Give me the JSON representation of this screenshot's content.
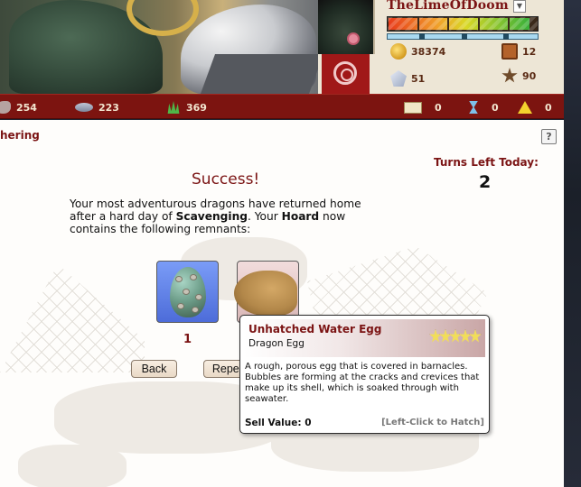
{
  "user": {
    "username": "TheLimeOfDoom",
    "energy_fraction": 0.95,
    "xp_fraction": 0.5,
    "stats": {
      "gold": "38374",
      "gems": "51",
      "books": "12",
      "stars": "90"
    }
  },
  "resources": {
    "ore": "254",
    "stone": "223",
    "plants": "369"
  },
  "notifications": {
    "mail": "0",
    "hourglass": "0",
    "alerts": "0"
  },
  "page": {
    "section_title": "hering",
    "help_label": "?",
    "turns_label": "Turns Left Today:",
    "turns_value": "2",
    "success_title": "Success!",
    "message_part1": "Your most adventurous dragons have returned home after a hard day of ",
    "message_bold1": "Scavenging",
    "message_part2": ". Your ",
    "message_bold2": "Hoard",
    "message_part3": " now contains the following remnants:"
  },
  "items": [
    {
      "name": "Unhatched Water Egg",
      "count": "1"
    },
    {
      "name": "Fungus"
    }
  ],
  "buttons": {
    "back": "Back",
    "repeat": "Repeat"
  },
  "tooltip": {
    "name": "Unhatched Water Egg",
    "type": "Dragon Egg",
    "rarity_stars": 5,
    "description": "A rough, porous egg that is covered in barnacles. Bubbles are forming at the cracks and crevices that make up its shell, which is soaked through with seawater.",
    "sell_value": "Sell Value: 0",
    "hint": "[Left-Click to Hatch]"
  },
  "colors": {
    "accent_red": "#7b1414",
    "header_bar": "#7c1410",
    "egg_card_bg": "#6a86ec",
    "fungus_card_bg": "#e8caca"
  }
}
